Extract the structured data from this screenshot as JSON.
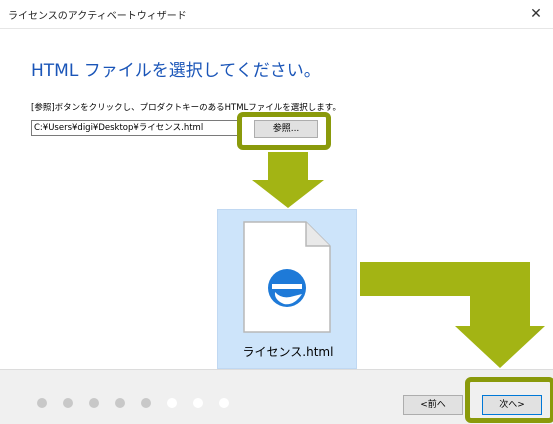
{
  "window": {
    "title": "ライセンスのアクティベートウィザード",
    "close_glyph": "✕"
  },
  "main": {
    "heading": "HTML ファイルを選択してください。",
    "instruction": "[参照]ボタンをクリックし、プロダクトキーのあるHTMLファイルを選択します。",
    "file_path": "C:¥Users¥digi¥Desktop¥ライセンス.html",
    "browse_label": "参照..."
  },
  "file_tile": {
    "icon": "edge-html-file-icon",
    "file_name": "ライセンス.html"
  },
  "footer": {
    "steps_total": 8,
    "steps_completed": 5,
    "prev_label": "<前へ",
    "next_label": "次へ>"
  },
  "colors": {
    "accent_blue": "#1a55b8",
    "highlight_olive": "#8a9a0b",
    "arrow_green": "#a3b414",
    "tile_selected": "#cde4fa",
    "edge_blue": "#1e7ad8"
  }
}
